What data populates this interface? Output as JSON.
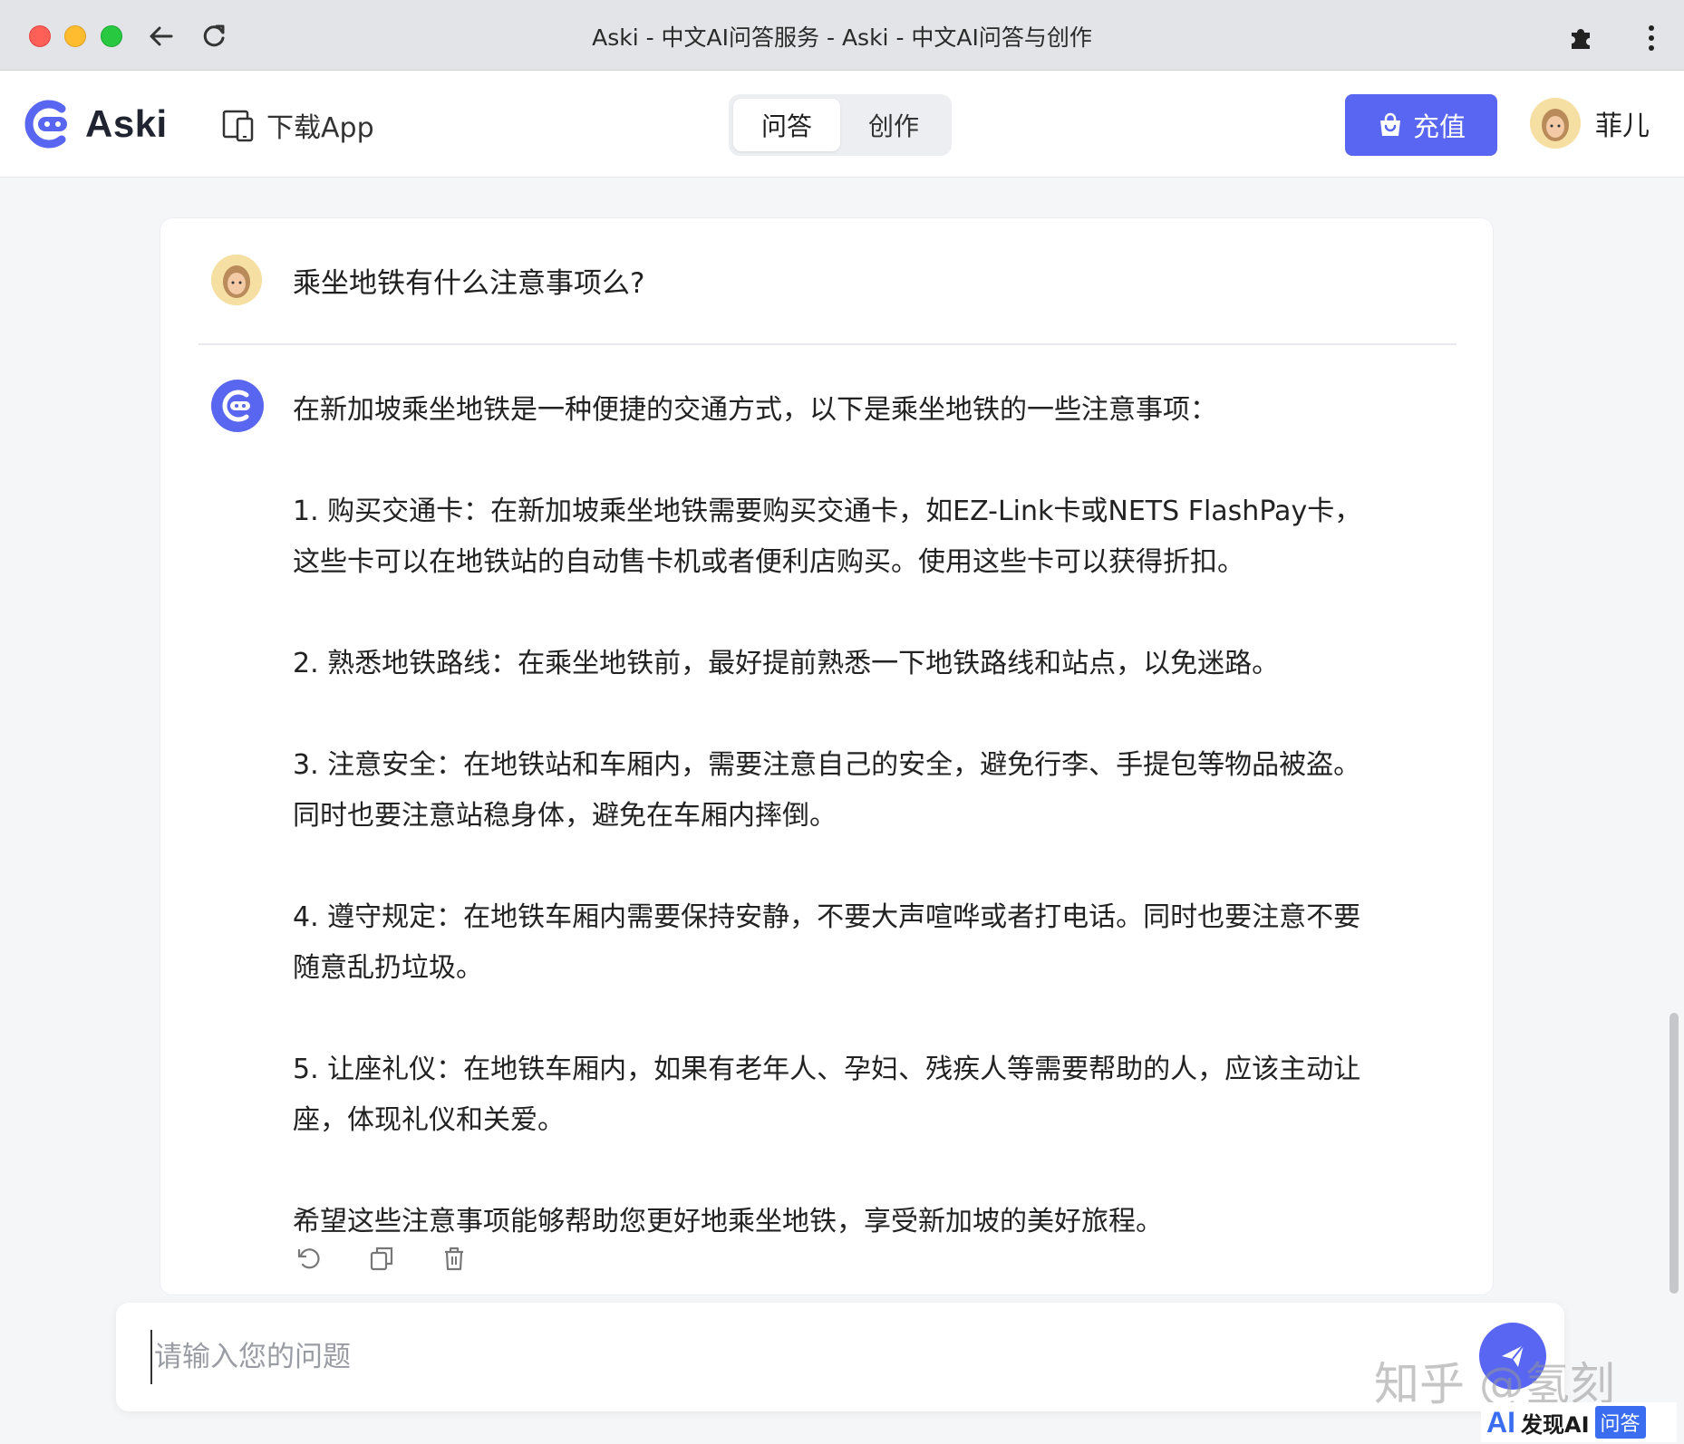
{
  "browser": {
    "tab_title": "Aski - 中文AI问答服务 - Aski - 中文AI问答与创作",
    "icons": [
      "close-light",
      "minimize-light",
      "zoom-light",
      "back-arrow-icon",
      "reload-icon",
      "puzzle-icon",
      "kebab-menu-icon"
    ]
  },
  "header": {
    "logo_text": "Aski",
    "download_label": "下载App",
    "tabs": [
      {
        "label": "问答",
        "active": true
      },
      {
        "label": "创作",
        "active": false
      }
    ],
    "recharge_label": "充值",
    "user_name": "菲儿"
  },
  "conversation": {
    "question": "乘坐地铁有什么注意事项么?",
    "answer": {
      "intro": "在新加坡乘坐地铁是一种便捷的交通方式，以下是乘坐地铁的一些注意事项：",
      "items": [
        [
          "1. 购买交通卡：在新加坡乘坐地铁需要购买交通卡，如EZ-Link卡或NETS FlashPay卡，",
          "这些卡可以在地铁站的自动售卡机或者便利店购买。使用这些卡可以获得折扣。"
        ],
        [
          "2. 熟悉地铁路线：在乘坐地铁前，最好提前熟悉一下地铁路线和站点，以免迷路。"
        ],
        [
          "3. 注意安全：在地铁站和车厢内，需要注意自己的安全，避免行李、手提包等物品被盗。",
          "同时也要注意站稳身体，避免在车厢内摔倒。"
        ],
        [
          "4. 遵守规定：在地铁车厢内需要保持安静，不要大声喧哗或者打电话。同时也要注意不要",
          "随意乱扔垃圾。"
        ],
        [
          "5. 让座礼仪：在地铁车厢内，如果有老年人、孕妇、残疾人等需要帮助的人，应该主动让",
          "座，体现礼仪和关爱。"
        ]
      ],
      "outro": "希望这些注意事项能够帮助您更好地乘坐地铁，享受新加坡的美好旅程。"
    },
    "action_icons": [
      "regenerate-icon",
      "copy-icon",
      "delete-icon"
    ]
  },
  "input": {
    "placeholder": "请输入您的问题"
  },
  "colors": {
    "accent": "#5866f2",
    "background": "#f5f6f8",
    "card": "#ffffff",
    "chrome": "#e3e4e8"
  },
  "watermark": {
    "zhihu": "知乎 @氢刻",
    "badge_ai": "AI",
    "badge_text": "发现AI",
    "badge_tag": "问答"
  }
}
